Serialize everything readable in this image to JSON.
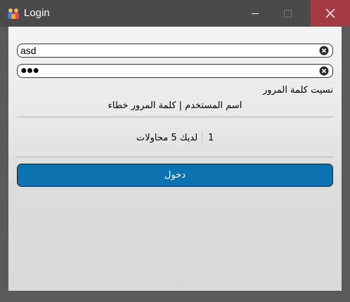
{
  "window": {
    "title": "Login",
    "app_icon": "users-icon",
    "controls": {
      "minimize": "minimize-icon",
      "maximize": "maximize-icon",
      "close": "close-icon"
    },
    "close_color": "#a33b44"
  },
  "form": {
    "username": {
      "value": "asd",
      "clear_icon": "clear-icon"
    },
    "password": {
      "value": "●●●",
      "clear_icon": "clear-icon"
    },
    "forgot_password": "نسيت كلمة المرور",
    "error_message": "اسم المستخدم | كلمة المرور خطاء",
    "attempts_label": "لديك 5 محاولات",
    "attempts_count": "1",
    "login_button": "دخول",
    "accent_color": "#0d73b0"
  }
}
